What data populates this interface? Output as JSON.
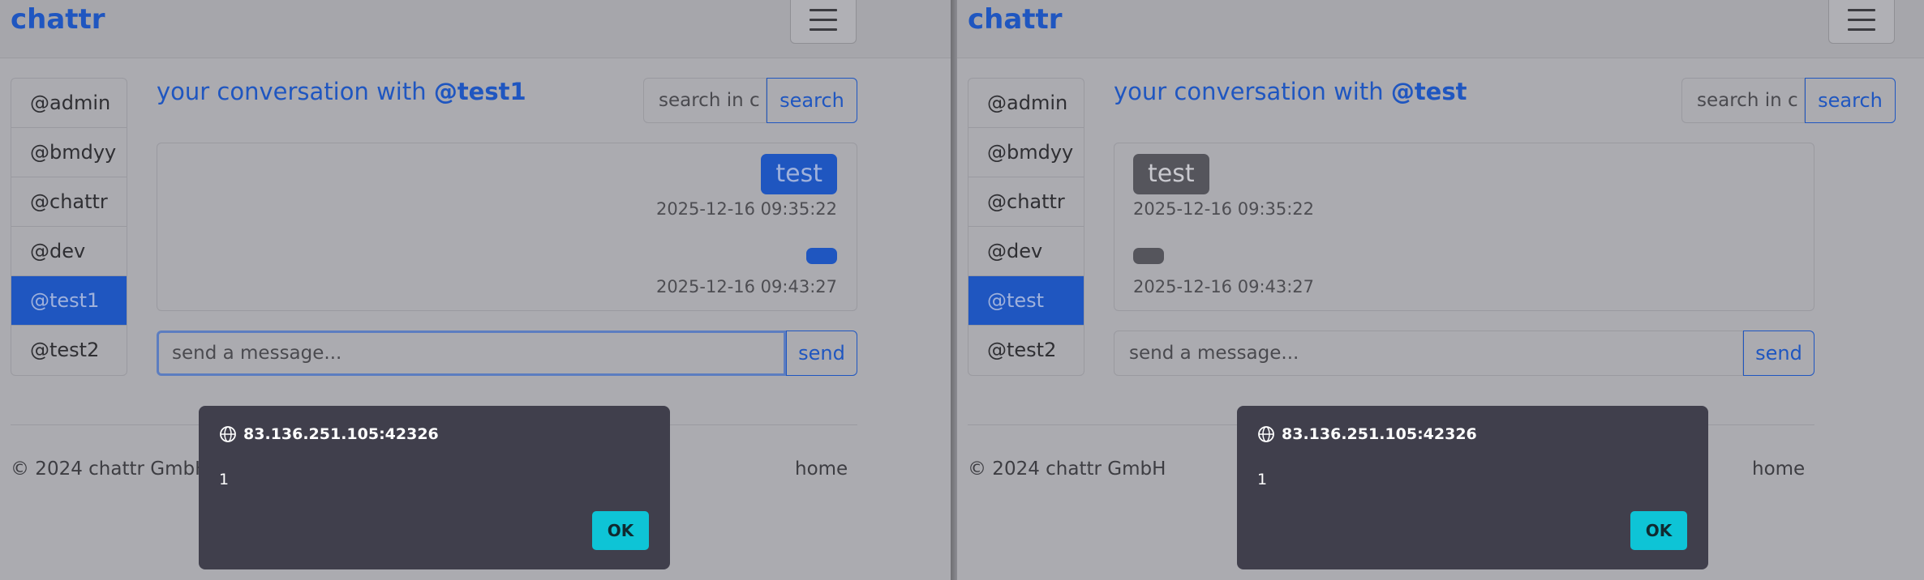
{
  "brand": "chattr",
  "users": [
    "@admin",
    "@bmdyy",
    "@chattr",
    "@dev"
  ],
  "last_user": "@test2",
  "conversation_prefix": "your conversation with ",
  "search": {
    "value": "search in c",
    "button": "search"
  },
  "send": {
    "placeholder": "send a message...",
    "button": "send"
  },
  "footer": {
    "copyright": "© 2024 chattr GmbH",
    "home": "home"
  },
  "dialog": {
    "origin": "83.136.251.105:42326",
    "message": "1",
    "ok": "OK"
  },
  "panes": {
    "left": {
      "active_user": "@test1",
      "conversation_user": "@test1",
      "messages": [
        {
          "text": "test",
          "time": "2025-12-16 09:35:22"
        },
        {
          "text": "",
          "time": "2025-12-16 09:43:27"
        }
      ]
    },
    "right": {
      "active_user": "@test",
      "conversation_user": "@test",
      "messages": [
        {
          "text": "test",
          "time": "2025-12-16 09:35:22"
        },
        {
          "text": "",
          "time": "2025-12-16 09:43:27"
        }
      ]
    }
  },
  "colors": {
    "accent": "#1f56c0",
    "sent_bubble": "#1f56c0",
    "received_bubble": "#55555c",
    "dialog_bg": "#403f4c",
    "ok_button": "#0ec4d6"
  }
}
